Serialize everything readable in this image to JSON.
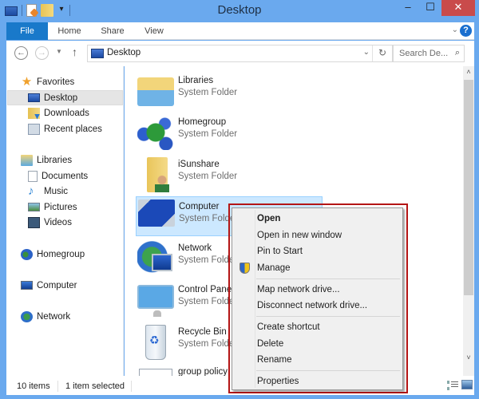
{
  "window": {
    "title": "Desktop",
    "controls": {
      "minimize": "–",
      "maximize": "☐",
      "close": "✕"
    }
  },
  "quick_access": [
    "system-icon",
    "properties-icon",
    "new-folder-icon",
    "customize-dropdown-icon"
  ],
  "ribbon": {
    "tabs": [
      "File",
      "Home",
      "Share",
      "View"
    ],
    "expand_icon": "⌄",
    "help_icon": "?"
  },
  "navigation": {
    "back_icon": "←",
    "forward_icon": "→",
    "recent_icon": "▼",
    "up_icon": "↑",
    "address": "Desktop",
    "address_dropdown_icon": "⌄",
    "refresh_icon": "↻",
    "search_placeholder": "Search De...",
    "search_icon": "⚲"
  },
  "sidebar": {
    "favorites": {
      "label": "Favorites",
      "items": [
        {
          "label": "Desktop",
          "selected": true
        },
        {
          "label": "Downloads"
        },
        {
          "label": "Recent places"
        }
      ]
    },
    "libraries": {
      "label": "Libraries",
      "items": [
        {
          "label": "Documents"
        },
        {
          "label": "Music"
        },
        {
          "label": "Pictures"
        },
        {
          "label": "Videos"
        }
      ]
    },
    "homegroup": "Homegroup",
    "computer": "Computer",
    "network": "Network"
  },
  "files": [
    {
      "name": "Libraries",
      "type": "System Folder"
    },
    {
      "name": "Homegroup",
      "type": "System Folder"
    },
    {
      "name": "iSunshare",
      "type": "System Folder"
    },
    {
      "name": "Computer",
      "type": "System Folder",
      "selected": true
    },
    {
      "name": "Network",
      "type": "System Folder"
    },
    {
      "name": "Control Panel",
      "type": "System Folder"
    },
    {
      "name": "Recycle Bin",
      "type": "System Folder"
    },
    {
      "name": "group policy",
      "type": ""
    }
  ],
  "context_menu": {
    "items": [
      {
        "label": "Open",
        "bold": true
      },
      {
        "label": "Open in new window"
      },
      {
        "label": "Pin to Start"
      },
      {
        "label": "Manage",
        "icon": "shield-icon"
      },
      {
        "label": "Map network drive..."
      },
      {
        "label": "Disconnect network drive..."
      },
      {
        "label": "Create shortcut"
      },
      {
        "label": "Delete"
      },
      {
        "label": "Rename"
      },
      {
        "label": "Properties"
      }
    ],
    "highlight_color": "#b41515"
  },
  "status": {
    "item_count": "10 items",
    "selection": "1 item selected"
  },
  "scrollbar": {
    "up_icon": "˄",
    "down_icon": "˅"
  },
  "colors": {
    "titlebar": "#6aa9ee",
    "file_tab": "#1979ca",
    "close_button": "#c94b4b",
    "selection": "#cce8ff"
  }
}
